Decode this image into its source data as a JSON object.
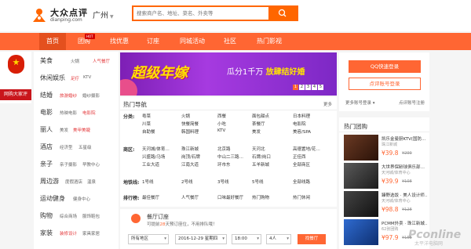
{
  "header": {
    "logo_cn": "大众点评",
    "logo_en": "dianping.com",
    "city": "广州",
    "search_placeholder": "搜索商户名、地址、菜名、外卖等"
  },
  "nav": {
    "items": [
      "首页",
      "团购",
      "找优惠",
      "订座",
      "同城活动",
      "社区",
      "热门影视"
    ],
    "hot_tag": "HOT"
  },
  "badge": {
    "label": "网购大家评"
  },
  "categories": [
    {
      "main": "美食",
      "subs": [
        "火锅",
        "人气餐厅"
      ]
    },
    {
      "main": "休闲娱乐",
      "subs": [
        "足疗",
        "KTV"
      ]
    },
    {
      "main": "结婚",
      "subs": [
        "旅游婚纱",
        "婚纱摄影"
      ]
    },
    {
      "main": "电影",
      "subs": [
        "热映电影",
        "电影院"
      ]
    },
    {
      "main": "丽人",
      "subs": [
        "美发",
        "美甲美睫"
      ]
    },
    {
      "main": "酒店",
      "subs": [
        "经济型",
        "五星级"
      ]
    },
    {
      "main": "亲子",
      "subs": [
        "亲子摄影",
        "早教中心"
      ]
    },
    {
      "main": "周边游",
      "subs": [
        "度假酒店",
        "温泉"
      ]
    },
    {
      "main": "运动健身",
      "subs": [
        "健身中心",
        ""
      ]
    },
    {
      "main": "购物",
      "subs": [
        "综合商场",
        "服饰鞋包"
      ]
    },
    {
      "main": "家装",
      "subs": [
        "装修设计",
        "家具家居"
      ]
    }
  ],
  "banner": {
    "headline": "超级年嫁",
    "sub_a": "瓜分1千万",
    "sub_b": "放肆结好婚",
    "pages": [
      "1",
      "2",
      "3",
      "4",
      "5"
    ]
  },
  "login": {
    "qq": "QQ快速登录",
    "dp": "点评账号登录",
    "more": "更多账号登录",
    "register": "点评账号注册"
  },
  "hot_nav": {
    "title": "热门导航",
    "more": "更多",
    "rows": [
      {
        "label": "分类:",
        "lines": [
          [
            "粤菜",
            "火锅",
            "西餐",
            "面包甜点",
            "日本料理"
          ],
          [
            "川菜",
            "快餐简餐",
            "小吃",
            "茶餐厅",
            "电影院"
          ],
          [
            "自助餐",
            "韩国料理",
            "KTV",
            "美发",
            "美容/SPA"
          ]
        ]
      },
      {
        "label": "商区:",
        "lines": [
          [
            "天河城/体育…",
            "珠江新城",
            "北京路",
            "天河北",
            "高德置地/花…"
          ],
          [
            "兴盛路/马场",
            "岗顶/石牌",
            "中山二三路…",
            "石牌/岗口",
            "正佳西"
          ],
          [
            "工业大道",
            "江南大道",
            "环市东",
            "五羊新城",
            "全部商区"
          ]
        ]
      },
      {
        "label": "地铁线:",
        "lines": [
          [
            "1号线",
            "2号线",
            "3号线",
            "5号线",
            "全部线路"
          ]
        ]
      },
      {
        "label": "排行榜:",
        "lines": [
          [
            "最佳餐厅",
            "人气餐厅",
            "口味最好餐厅",
            "热门购物",
            "热门休闲"
          ]
        ]
      }
    ]
  },
  "restaurant": {
    "title": "餐厅订座",
    "desc_a": "可提前",
    "desc_days": "28",
    "desc_b": "天预订座位，不用排队哦！",
    "area": "所有地区",
    "date": "2016-12-29 星期四",
    "time": "18:00",
    "people": "4人",
    "button": "找餐厅"
  },
  "hot_deals": {
    "title": "热门团购",
    "items": [
      {
        "name": "凯乐金曼厨KTV(国防…",
        "area": "珠江新城",
        "price": "¥39.8",
        "orig": "¥299",
        "color": "#4a2a1a"
      },
      {
        "name": "大世界保龄球俱乐部…",
        "area": "天河城/体育中心",
        "price": "¥39.9",
        "orig": "¥108",
        "color": "#3a3a3a"
      },
      {
        "name": "臻野选饭 · 美人设计师…",
        "area": "天河城/体育中心",
        "price": "¥98.8",
        "orig": "¥128",
        "color": "#2b2b2b"
      },
      {
        "name": "PCMM外卖 · 珠江新城…",
        "area": "62张团购",
        "price": "¥97.9",
        "orig": "¥158",
        "color": "#1f4fa8"
      }
    ]
  },
  "watermark": {
    "main": "Pconline",
    "sub": "太平洋电脑网"
  },
  "colors": {
    "accent": "#ff6633",
    "nav_active": "#e4501e",
    "badge_red": "#c9161c"
  }
}
